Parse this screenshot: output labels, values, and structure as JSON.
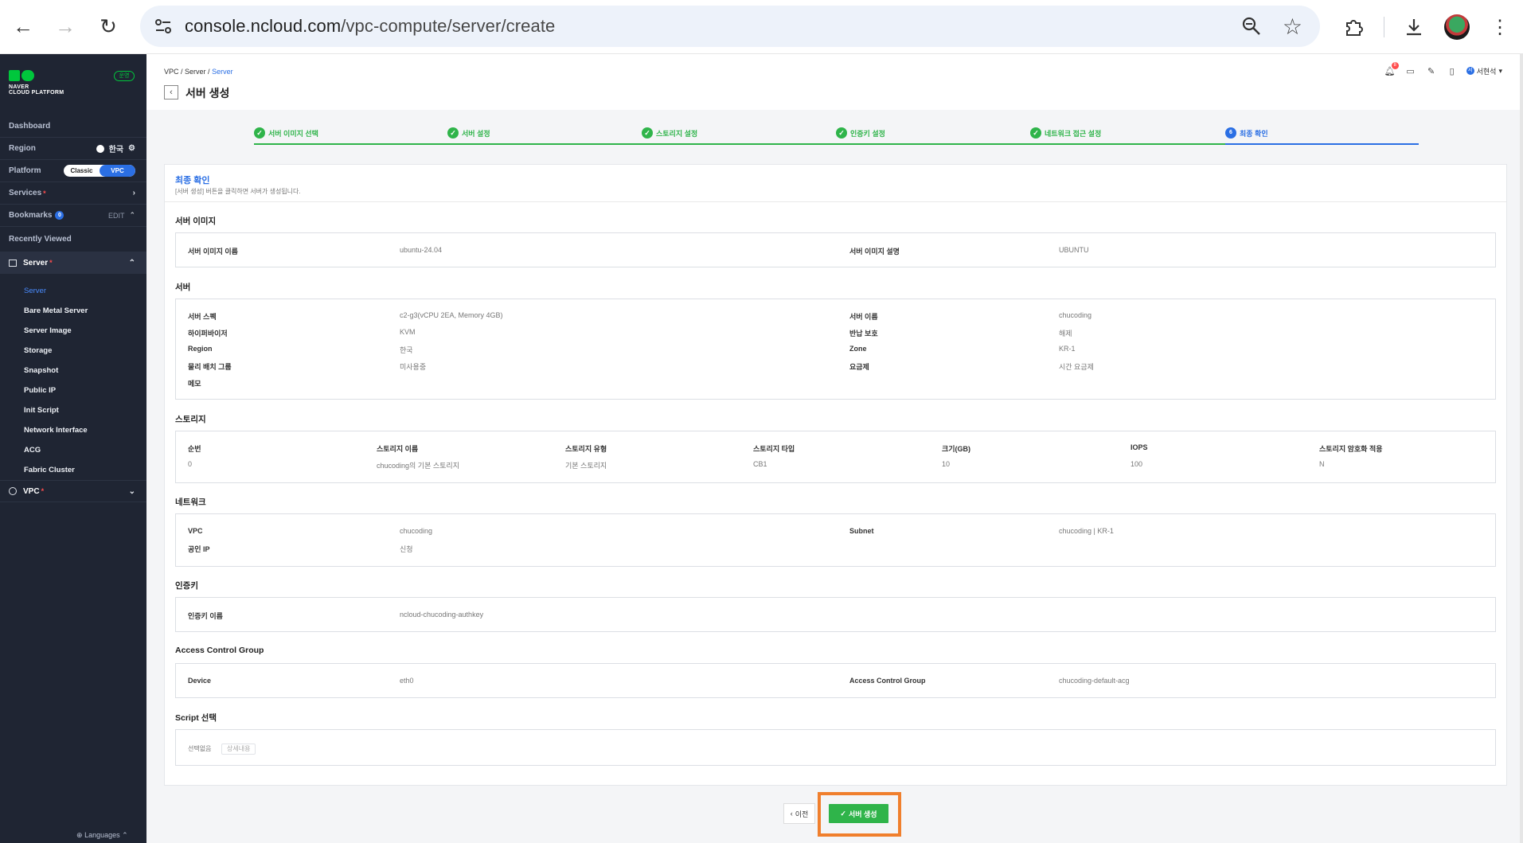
{
  "browser": {
    "url_host": "console.ncloud.com",
    "url_path": "/vpc-compute/server/create"
  },
  "sidebar": {
    "logo_line1": "NAVER",
    "logo_line2": "CLOUD PLATFORM",
    "env_badge": "운영",
    "dashboard": "Dashboard",
    "region_label": "Region",
    "region_value": "한국",
    "platform_label": "Platform",
    "platform_options": [
      "Classic",
      "VPC"
    ],
    "services": "Services",
    "bookmarks": "Bookmarks",
    "bookmarks_count": "0",
    "bookmarks_edit": "EDIT",
    "recently_viewed": "Recently Viewed",
    "server_group": "Server",
    "server_items": [
      "Server",
      "Bare Metal Server",
      "Server Image",
      "Storage",
      "Snapshot",
      "Public IP",
      "Init Script",
      "Network Interface",
      "ACG",
      "Fabric Cluster"
    ],
    "vpc_group": "VPC",
    "languages": "Languages"
  },
  "header": {
    "breadcrumb": [
      "VPC",
      "Server",
      "Server"
    ],
    "title": "서버 생성",
    "notif_count": "8",
    "user_initial": "서",
    "user_name": "서현석"
  },
  "steps": [
    "서버 이미지 선택",
    "서버 설정",
    "스토리지 설정",
    "인증키 설정",
    "네트워크 접근 설정",
    "최종 확인"
  ],
  "current_step_number": "6",
  "panel": {
    "heading": "최종 확인",
    "subheading": "[서버 생성] 버튼을 클릭하면 서버가 생성됩니다."
  },
  "server_image": {
    "title": "서버 이미지",
    "name_label": "서버 이미지 이름",
    "name_value": "ubuntu-24.04",
    "desc_label": "서버 이미지 설명",
    "desc_value": "UBUNTU"
  },
  "server": {
    "title": "서버",
    "spec_label": "서버 스펙",
    "spec_value": "c2-g3(vCPU 2EA, Memory 4GB)",
    "name_label": "서버 이름",
    "name_value": "chucoding",
    "hyp_label": "하이퍼바이저",
    "hyp_value": "KVM",
    "protect_label": "반납 보호",
    "protect_value": "해제",
    "region_label": "Region",
    "region_value": "한국",
    "zone_label": "Zone",
    "zone_value": "KR-1",
    "placement_label": "물리 배치 그룹",
    "placement_value": "미사용중",
    "fee_label": "요금제",
    "fee_value": "시간 요금제",
    "memo_label": "메모"
  },
  "storage": {
    "title": "스토리지",
    "headers": [
      "순번",
      "스토리지 이름",
      "스토리지 유형",
      "스토리지 타입",
      "크기(GB)",
      "IOPS",
      "스토리지 암호화 적용"
    ],
    "row": [
      "0",
      "chucoding의 기본 스토리지",
      "기본 스토리지",
      "CB1",
      "10",
      "100",
      "N"
    ]
  },
  "network": {
    "title": "네트워크",
    "vpc_label": "VPC",
    "vpc_value": "chucoding",
    "subnet_label": "Subnet",
    "subnet_value": "chucoding | KR-1",
    "ip_label": "공인 IP",
    "ip_value": "신청"
  },
  "authkey": {
    "title": "인증키",
    "label": "인증키 이름",
    "value": "ncloud-chucoding-authkey"
  },
  "acg": {
    "title": "Access Control Group",
    "device_label": "Device",
    "device_value": "eth0",
    "acg_label": "Access Control Group",
    "acg_value": "chucoding-default-acg"
  },
  "script": {
    "title": "Script 선택",
    "label": "선택없음",
    "detail": "상세내용"
  },
  "buttons": {
    "prev": "이전",
    "create": "서버 생성"
  },
  "colors": {
    "accent_green": "#2fb44a",
    "accent_blue": "#2b6fe4",
    "highlight": "#f07f2d",
    "sidebar_bg": "#1f2533"
  }
}
